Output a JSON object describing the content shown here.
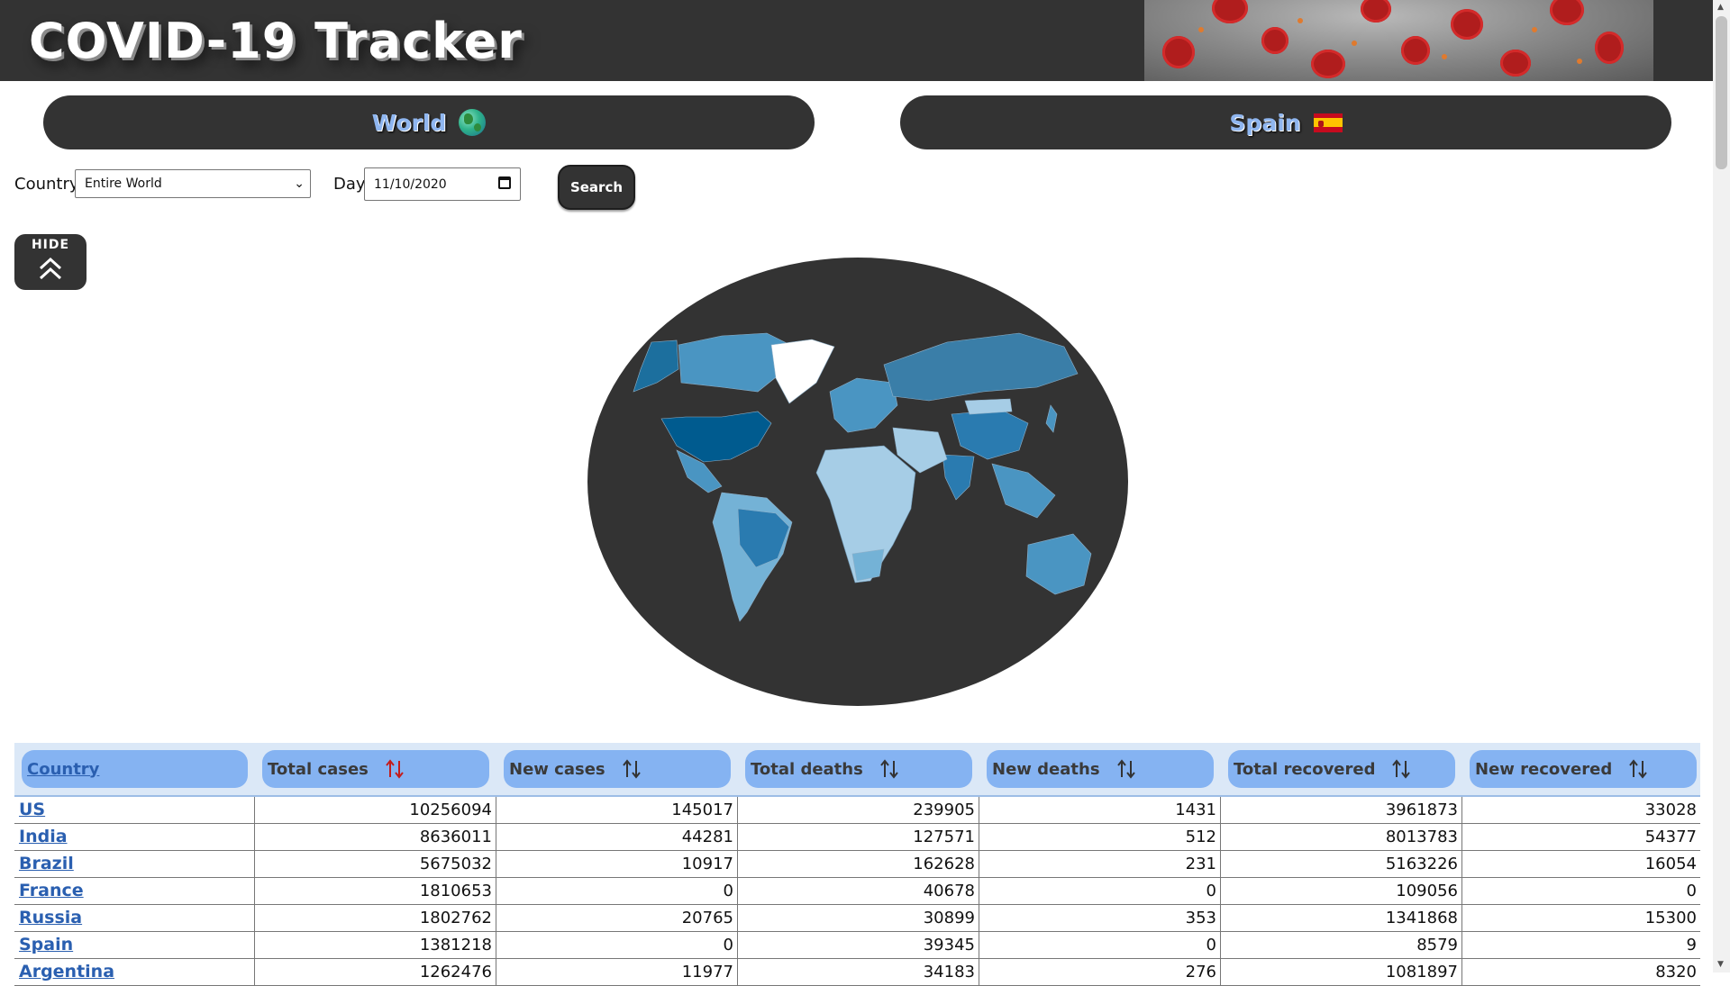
{
  "app": {
    "title": "COVID-19 Tracker"
  },
  "nav": {
    "world_label": "World",
    "spain_label": "Spain",
    "world_icon": "globe-icon",
    "spain_icon": "spain-flag-icon"
  },
  "filters": {
    "country_label": "Country",
    "country_value": "Entire World",
    "day_label": "Day",
    "day_value": "11/10/2020",
    "search_label": "Search"
  },
  "hide_button": {
    "label": "HIDE",
    "icon": "double-chevron-up-icon"
  },
  "colors": {
    "header_bg": "#333333",
    "nav_text": "#8fb6f0",
    "table_header_bg": "#85b3f2",
    "map_scale": [
      "#005b8f",
      "#2a7bb0",
      "#4a95c2",
      "#74b2d6",
      "#a6cde6"
    ]
  },
  "table": {
    "columns": [
      "Country",
      "Total cases",
      "New cases",
      "Total deaths",
      "New deaths",
      "Total recovered",
      "New recovered"
    ],
    "rows": [
      [
        "US",
        "10256094",
        "145017",
        "239905",
        "1431",
        "3961873",
        "33028"
      ],
      [
        "India",
        "8636011",
        "44281",
        "127571",
        "512",
        "8013783",
        "54377"
      ],
      [
        "Brazil",
        "5675032",
        "10917",
        "162628",
        "231",
        "5163226",
        "16054"
      ],
      [
        "France",
        "1810653",
        "0",
        "40678",
        "0",
        "109056",
        "0"
      ],
      [
        "Russia",
        "1802762",
        "20765",
        "30899",
        "353",
        "1341868",
        "15300"
      ],
      [
        "Spain",
        "1381218",
        "0",
        "39345",
        "0",
        "8579",
        "9"
      ],
      [
        "Argentina",
        "1262476",
        "11977",
        "34183",
        "276",
        "1081897",
        "8320"
      ]
    ]
  }
}
